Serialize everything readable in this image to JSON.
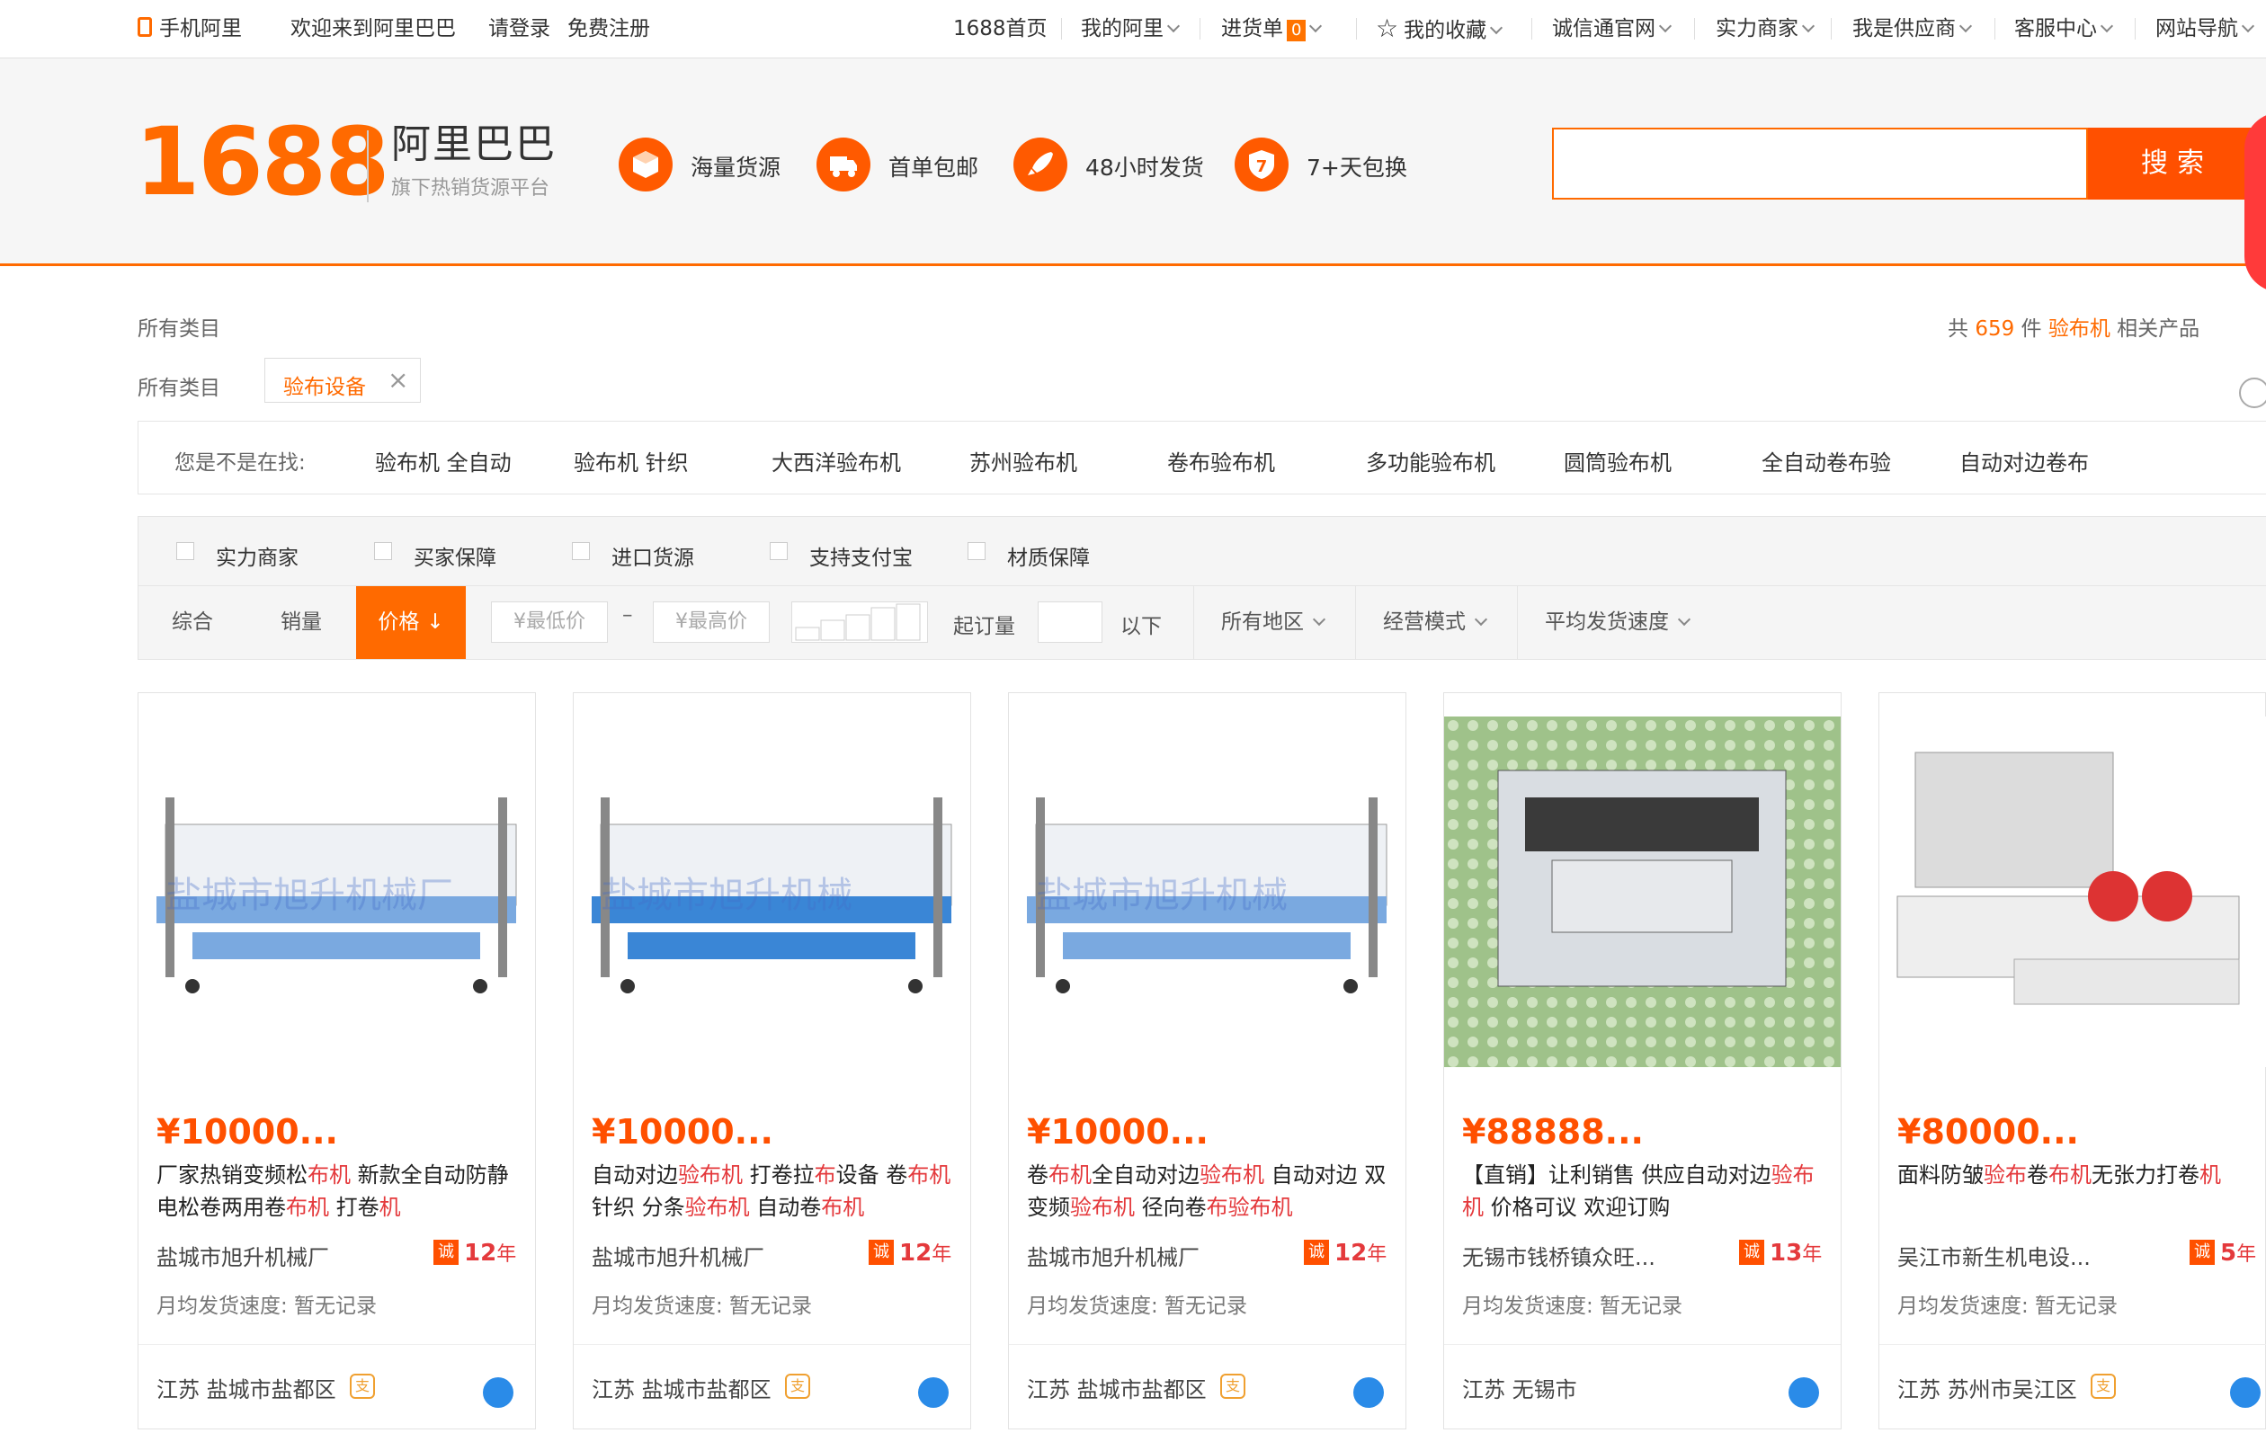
{
  "topbar": {
    "mobile": "手机阿里",
    "welcome": "欢迎来到阿里巴巴",
    "login": "请登录",
    "register": "免费注册",
    "home": "1688首页",
    "my_ali": "我的阿里",
    "cart": "进货单",
    "cart_count": "0",
    "favorites": "我的收藏",
    "chengxin": "诚信通官网",
    "strong": "实力商家",
    "supplier": "我是供应商",
    "service": "客服中心",
    "sitenav": "网站导航"
  },
  "header": {
    "logo_num": "1688",
    "logo_name": "阿里巴巴",
    "logo_sub": "旗下热销货源平台",
    "features": [
      "海量货源",
      "首单包邮",
      "48小时发货",
      "7+天包换"
    ],
    "search_button": "搜索",
    "search_value": ""
  },
  "category": {
    "crumb": "所有类目",
    "crumb2": "所有类目",
    "tag": "验布设备",
    "total_prefix": "共",
    "total_num": "659",
    "total_unit": "件",
    "keyword": "验布机",
    "total_suffix": "相关产品"
  },
  "suggest": {
    "label": "您是不是在找:",
    "items": [
      "验布机 全自动",
      "验布机 针织",
      "大西洋验布机",
      "苏州验布机",
      "卷布验布机",
      "多功能验布机",
      "圆筒验布机",
      "全自动卷布验",
      "自动对边卷布"
    ]
  },
  "filters": {
    "checks": [
      "实力商家",
      "买家保障",
      "进口货源",
      "支持支付宝",
      "材质保障"
    ],
    "sorts": [
      "综合",
      "销量",
      "价格"
    ],
    "min_price": "¥最低价",
    "max_price": "¥最高价",
    "dash": "–",
    "qty_label": "起订量",
    "qty_suffix": "以下",
    "region": "所有地区",
    "mode": "经营模式",
    "ship": "平均发货速度"
  },
  "products": [
    {
      "price": "¥10000...",
      "title": [
        [
          "厂家热销变频松",
          ""
        ],
        [
          "布机",
          "hl"
        ],
        [
          " 新款全自动防静电松卷两用卷",
          ""
        ],
        [
          "布机",
          "hl"
        ],
        [
          " 打卷",
          ""
        ],
        [
          "机",
          "hl"
        ]
      ],
      "company": "盐城市旭升机械厂",
      "cheng_badge": "诚",
      "years": "12",
      "years_unit": "年",
      "speed": "月均发货速度: 暂无记录",
      "location": "江苏 盐城市盐都区",
      "alipay": "支",
      "watermark": "盐城市旭升机械厂"
    },
    {
      "price": "¥10000...",
      "title": [
        [
          "自动对边",
          ""
        ],
        [
          "验布机",
          "hl"
        ],
        [
          " 打卷拉",
          ""
        ],
        [
          "布",
          "hl"
        ],
        [
          "设备 卷",
          ""
        ],
        [
          "布机",
          "hl"
        ],
        [
          " 针织 分条",
          ""
        ],
        [
          "验布机",
          "hl"
        ],
        [
          " 自动卷",
          ""
        ],
        [
          "布机",
          "hl"
        ]
      ],
      "company": "盐城市旭升机械厂",
      "cheng_badge": "诚",
      "years": "12",
      "years_unit": "年",
      "speed": "月均发货速度: 暂无记录",
      "location": "江苏 盐城市盐都区",
      "alipay": "支",
      "watermark": "盐城市旭升机械"
    },
    {
      "price": "¥10000...",
      "title": [
        [
          "卷",
          ""
        ],
        [
          "布机",
          "hl"
        ],
        [
          "全自动对边",
          ""
        ],
        [
          "验布机",
          "hl"
        ],
        [
          " 自动对边 双变频",
          ""
        ],
        [
          "验布机",
          "hl"
        ],
        [
          " 径向卷",
          ""
        ],
        [
          "布验布机",
          "hl"
        ]
      ],
      "company": "盐城市旭升机械厂",
      "cheng_badge": "诚",
      "years": "12",
      "years_unit": "年",
      "speed": "月均发货速度: 暂无记录",
      "location": "江苏 盐城市盐都区",
      "alipay": "支",
      "watermark": "盐城市旭升机械"
    },
    {
      "price": "¥88888...",
      "title": [
        [
          "【直销】让利销售 供应自动对边",
          ""
        ],
        [
          "验布机",
          "hl"
        ],
        [
          " 价格可议 欢迎订购",
          ""
        ]
      ],
      "company": "无锡市钱桥镇众旺...",
      "cheng_badge": "诚",
      "years": "13",
      "years_unit": "年",
      "speed": "月均发货速度: 暂无记录",
      "location": "江苏 无锡市",
      "alipay": "",
      "watermark": ""
    },
    {
      "price": "¥80000...",
      "title": [
        [
          "面料防皱",
          ""
        ],
        [
          "验布",
          "hl"
        ],
        [
          "卷",
          ""
        ],
        [
          "布机",
          "hl"
        ],
        [
          "无张力打卷",
          ""
        ],
        [
          "机",
          "hl"
        ]
      ],
      "company": "吴江市新生机电设...",
      "cheng_badge": "诚",
      "years": "5",
      "years_unit": "年",
      "speed": "月均发货速度: 暂无记录",
      "location": "江苏 苏州市吴江区",
      "alipay": "支",
      "watermark": ""
    }
  ]
}
